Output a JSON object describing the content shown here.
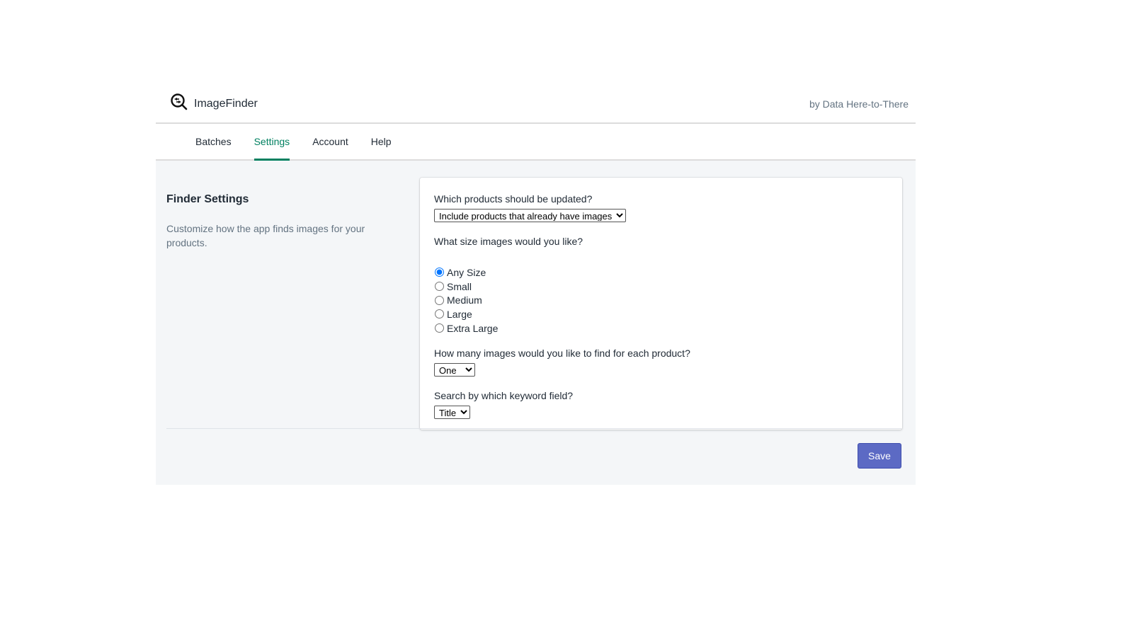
{
  "header": {
    "app_name": "ImageFinder",
    "byline": "by Data Here-to-There",
    "logo_icon": "magnifier-arrows-icon"
  },
  "nav": {
    "tabs": [
      {
        "label": "Batches"
      },
      {
        "label": "Settings",
        "active": true
      },
      {
        "label": "Account"
      },
      {
        "label": "Help"
      }
    ],
    "accent": "#008060"
  },
  "section": {
    "title": "Finder Settings",
    "description": "Customize how the app finds images for your products."
  },
  "form": {
    "products_question": "Which products should be updated?",
    "products_selected": "Include products that already have images",
    "size_question": "What size images would you like?",
    "sizes": [
      {
        "label": "Any Size",
        "checked": true
      },
      {
        "label": "Small"
      },
      {
        "label": "Medium"
      },
      {
        "label": "Large"
      },
      {
        "label": "Extra Large"
      }
    ],
    "count_question": "How many images would you like to find for each product?",
    "count_selected": "One",
    "keyword_question": "Search by which keyword field?",
    "keyword_selected": "Title"
  },
  "save_label": "Save",
  "colors": {
    "primary": "#5c6ac4"
  }
}
